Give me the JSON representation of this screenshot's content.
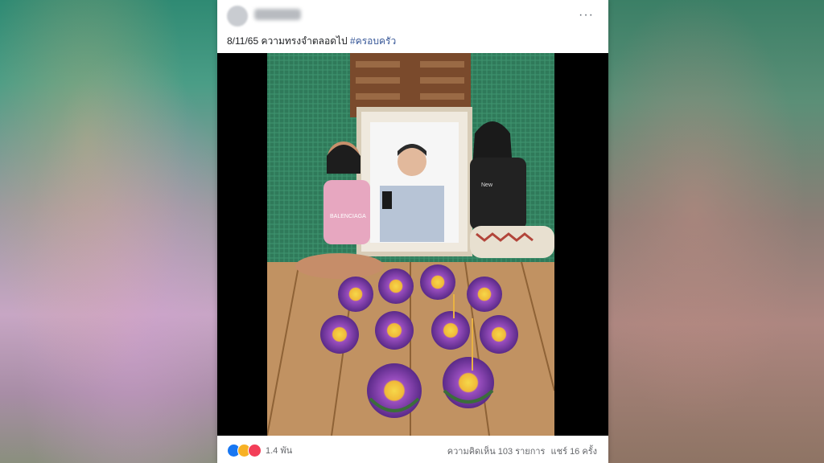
{
  "post": {
    "date_text": "8/11/65 ความทรงจำตลอดไป",
    "hashtag": "#ครอบครัว",
    "more_label": "···",
    "reactions_count": "1.4 พัน",
    "comments_text": "ความคิดเห็น 103 รายการ",
    "shares_text": "แชร์ 16 ครั้ง",
    "photo_shirt_text": "BALENCIAGA",
    "photo_shirt_text_2": "New"
  },
  "icons": {
    "reactions": [
      "like-icon",
      "haha-icon",
      "love-icon"
    ],
    "more": "more-options-icon"
  },
  "colors": {
    "hashtag": "#385898",
    "like": "#1877f2",
    "haha": "#f7b125",
    "love": "#f33e58"
  }
}
